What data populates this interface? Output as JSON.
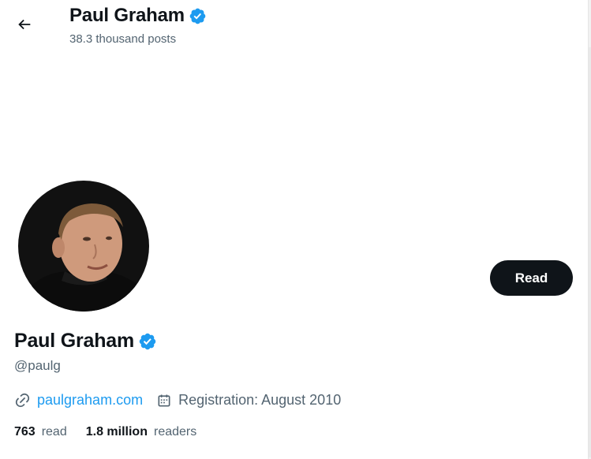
{
  "header": {
    "name": "Paul Graham",
    "posts_count": "38.3 thousand posts"
  },
  "profile": {
    "name": "Paul Graham",
    "handle": "@paulg",
    "action_button": "Read",
    "website": "paulgraham.com",
    "registration": "Registration: August 2010",
    "stats": {
      "read_count": "763",
      "read_label": "read",
      "readers_count": "1.8 million",
      "readers_label": "readers"
    }
  },
  "icons": {
    "back": "arrow-left-icon",
    "verified": "verified-badge-icon",
    "link": "link-icon",
    "calendar": "calendar-icon"
  },
  "colors": {
    "accent": "#1d9bf0",
    "text": "#0f1419",
    "secondary": "#536471",
    "button": "#0f1419"
  }
}
